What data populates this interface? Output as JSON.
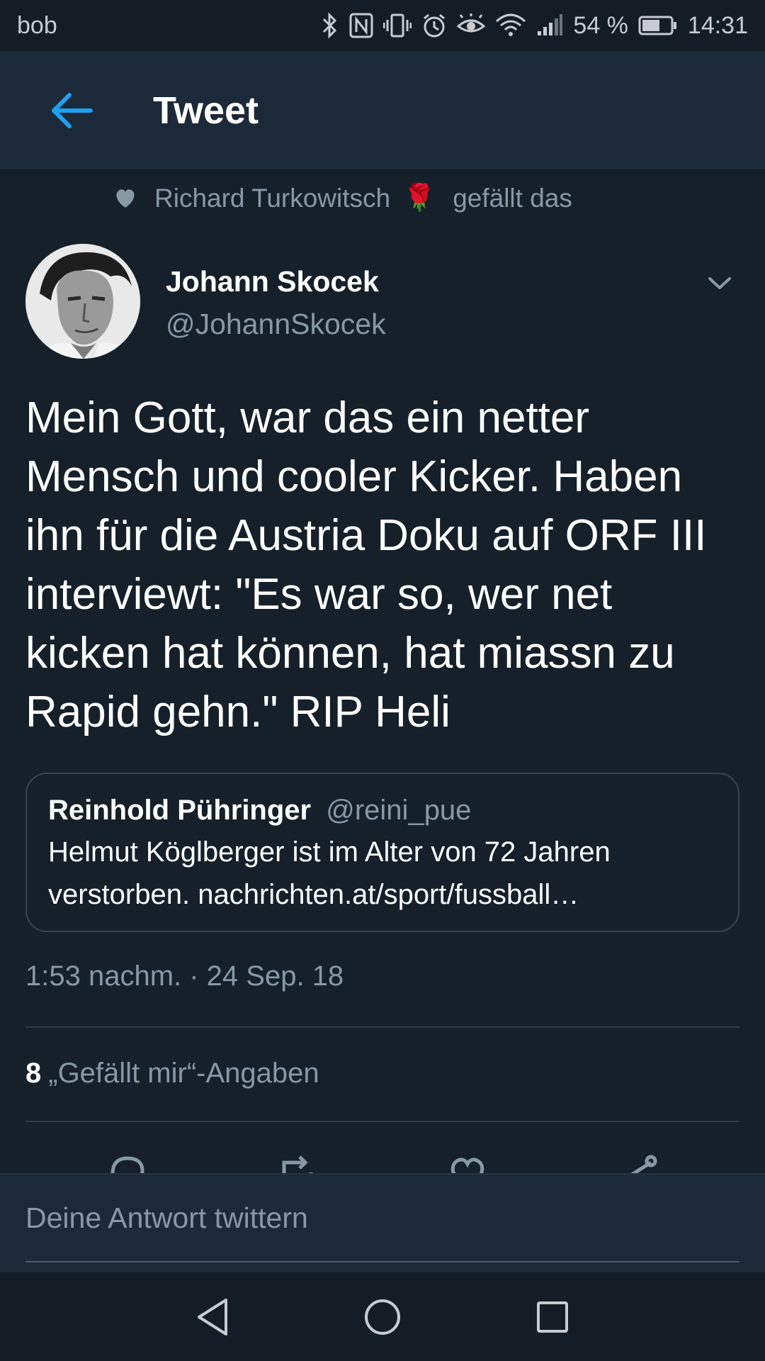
{
  "status_bar": {
    "carrier": "bob",
    "battery_percent": "54 %",
    "time": "14:31",
    "icons": [
      "bluetooth-icon",
      "nfc-icon",
      "vibrate-icon",
      "alarm-icon",
      "eye-comfort-icon",
      "wifi-icon",
      "signal-icon",
      "battery-icon"
    ]
  },
  "app_bar": {
    "title": "Tweet",
    "back_icon": "arrow-left-icon"
  },
  "social_context": {
    "liker_name": "Richard Turkowitsch",
    "emoji": "🌹",
    "suffix": "gefällt das"
  },
  "tweet": {
    "author_name": "Johann Skocek",
    "author_handle": "@JohannSkocek",
    "text": "Mein Gott, war das ein netter Mensch und cooler Kicker. Haben ihn für die Austria Doku auf ORF III interviewt: \"Es war so, wer net kicken hat können, hat miassn zu Rapid gehn.\" RIP Heli",
    "timestamp": "1:53 nachm. · 24 Sep. 18",
    "likes_count": "8",
    "likes_label": "„Gefällt mir“-Angaben"
  },
  "quoted_tweet": {
    "author_name": "Reinhold Pühringer",
    "author_handle": "@reini_pue",
    "text": "Helmut Köglberger ist im Alter von 72 Jahren verstorben. nachrichten.at/sport/fussball…"
  },
  "reply": {
    "placeholder": "Deine Antwort twittern"
  },
  "colors": {
    "background": "#15202b",
    "accent": "#1da1f2",
    "secondary_text": "#8899a6"
  }
}
